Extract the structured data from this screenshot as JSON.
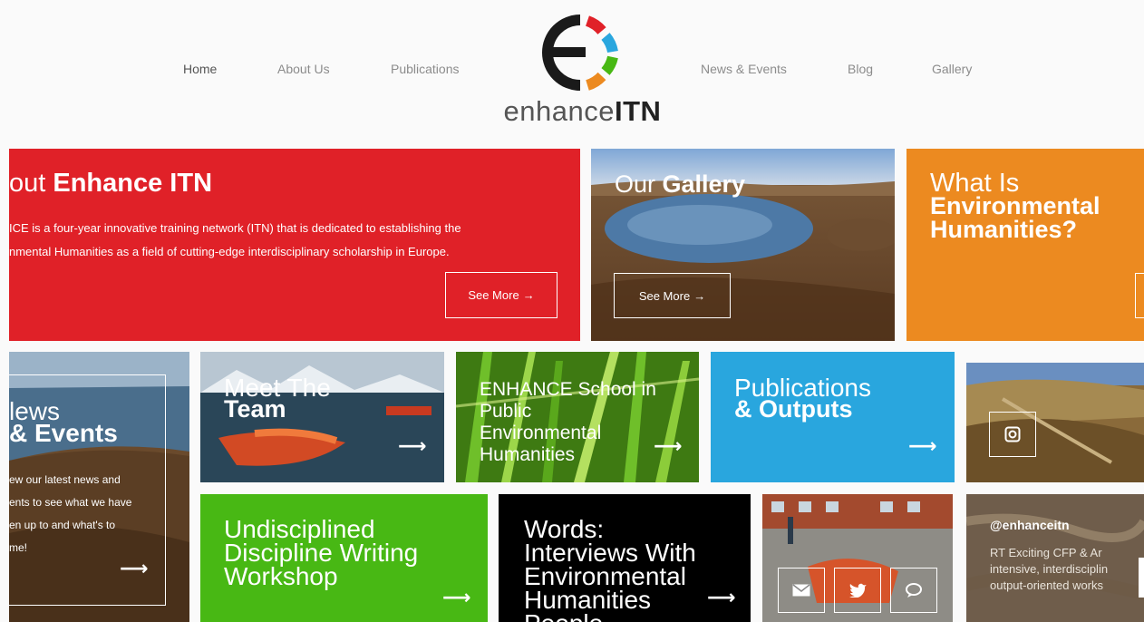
{
  "nav": {
    "home": "Home",
    "about": "About Us",
    "publications": "Publications",
    "news": "News & Events",
    "blog": "Blog",
    "gallery": "Gallery"
  },
  "logo": {
    "text_light": "enhance",
    "text_bold": "ITN",
    "letter": "E"
  },
  "about": {
    "title_light": "out ",
    "title_bold": "Enhance ITN",
    "line1": "ICE is a four-year innovative training network (ITN) that is dedicated to establishing the",
    "line2": "nmental Humanities as a field of cutting-edge interdisciplinary scholarship in Europe.",
    "button": "See More"
  },
  "gallery_tile": {
    "title_light": "Our ",
    "title_bold": "Gallery",
    "button": "See More"
  },
  "what_is": {
    "line1": "What Is",
    "line2": "Environmental",
    "line3": "Humanities?"
  },
  "news_tile": {
    "title1": "lews",
    "title2": "& Events",
    "line1": "ew our latest news and",
    "line2": "ents to see what we have",
    "line3": "en up to and what's to",
    "line4": "me!"
  },
  "team": {
    "line1": "Meet The",
    "line2": "Team"
  },
  "school": {
    "line1": "ENHANCE School in",
    "line2": "Public",
    "line3": "Environmental",
    "line4": "Humanities"
  },
  "pubs": {
    "line1": "Publications",
    "line2": "& Outputs"
  },
  "workshop": {
    "line1": "Undisciplined",
    "line2": "Discipline Writing",
    "line3": "Workshop"
  },
  "words": {
    "line1": "Words:",
    "line2": "Interviews With",
    "line3": "Environmental",
    "line4": "Humanities",
    "line5": "People"
  },
  "twitter": {
    "handle": "@enhanceitn",
    "line1": "RT  Exciting CFP &   Ar",
    "line2": "intensive, interdisciplin",
    "line3": "output-oriented works"
  },
  "glyphs": {
    "arrow": "→",
    "long_arrow": "⟶"
  },
  "colors": {
    "red": "#e02128",
    "orange": "#ec8a20",
    "blue": "#29a6de",
    "green": "#48b814",
    "black": "#000000",
    "logo_red": "#e02128",
    "logo_blue": "#29a6de",
    "logo_green": "#48b814",
    "logo_orange": "#ec8a20"
  },
  "icons": {
    "instagram": "instagram-icon",
    "email": "email-icon",
    "twitter": "twitter-icon",
    "chat": "chat-icon",
    "arrow": "arrow-right-icon"
  }
}
